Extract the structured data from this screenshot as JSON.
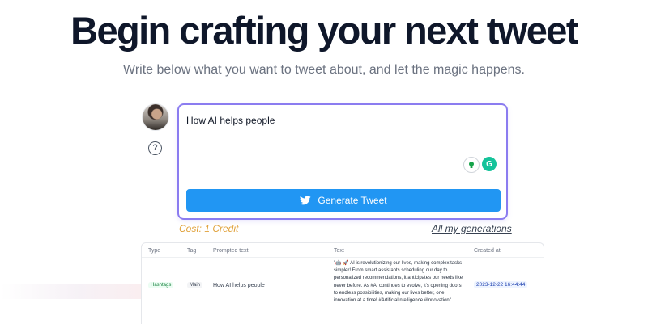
{
  "hero": {
    "title": "Begin crafting your next tweet",
    "subtitle": "Write below what you want to tweet about, and let the magic happens."
  },
  "composer": {
    "value": "How AI helps people",
    "help_glyph": "?",
    "generate_label": "Generate Tweet",
    "extension_icons": [
      "bulb-icon",
      "grammarly-icon"
    ],
    "grammarly_glyph": "G",
    "accent_color": "#8b7cf0",
    "button_color": "#2196f3"
  },
  "meta": {
    "cost": "Cost: 1 Credit",
    "all_generations_link": "All my generations",
    "cost_color": "#e0a13a"
  },
  "table": {
    "headers": {
      "type": "Type",
      "tag": "Tag",
      "prompted_text": "Prompted text",
      "text": "Text",
      "created_at": "Created at"
    },
    "rows": [
      {
        "type": "Hashtags",
        "tag": "Main",
        "prompted_text": "How AI helps people",
        "text": "\"🤖 🚀 AI is revolutionizing our lives, making complex tasks simpler! From smart assistants scheduling our day to personalized recommendations, it anticipates our needs like never before. As #AI continues to evolve, it's opening doors to endless possibilities, making our lives better, one innovation at a time! #ArtificialIntelligence #Innovation\"",
        "created_at": "2023-12-22 16:44:44"
      }
    ]
  }
}
